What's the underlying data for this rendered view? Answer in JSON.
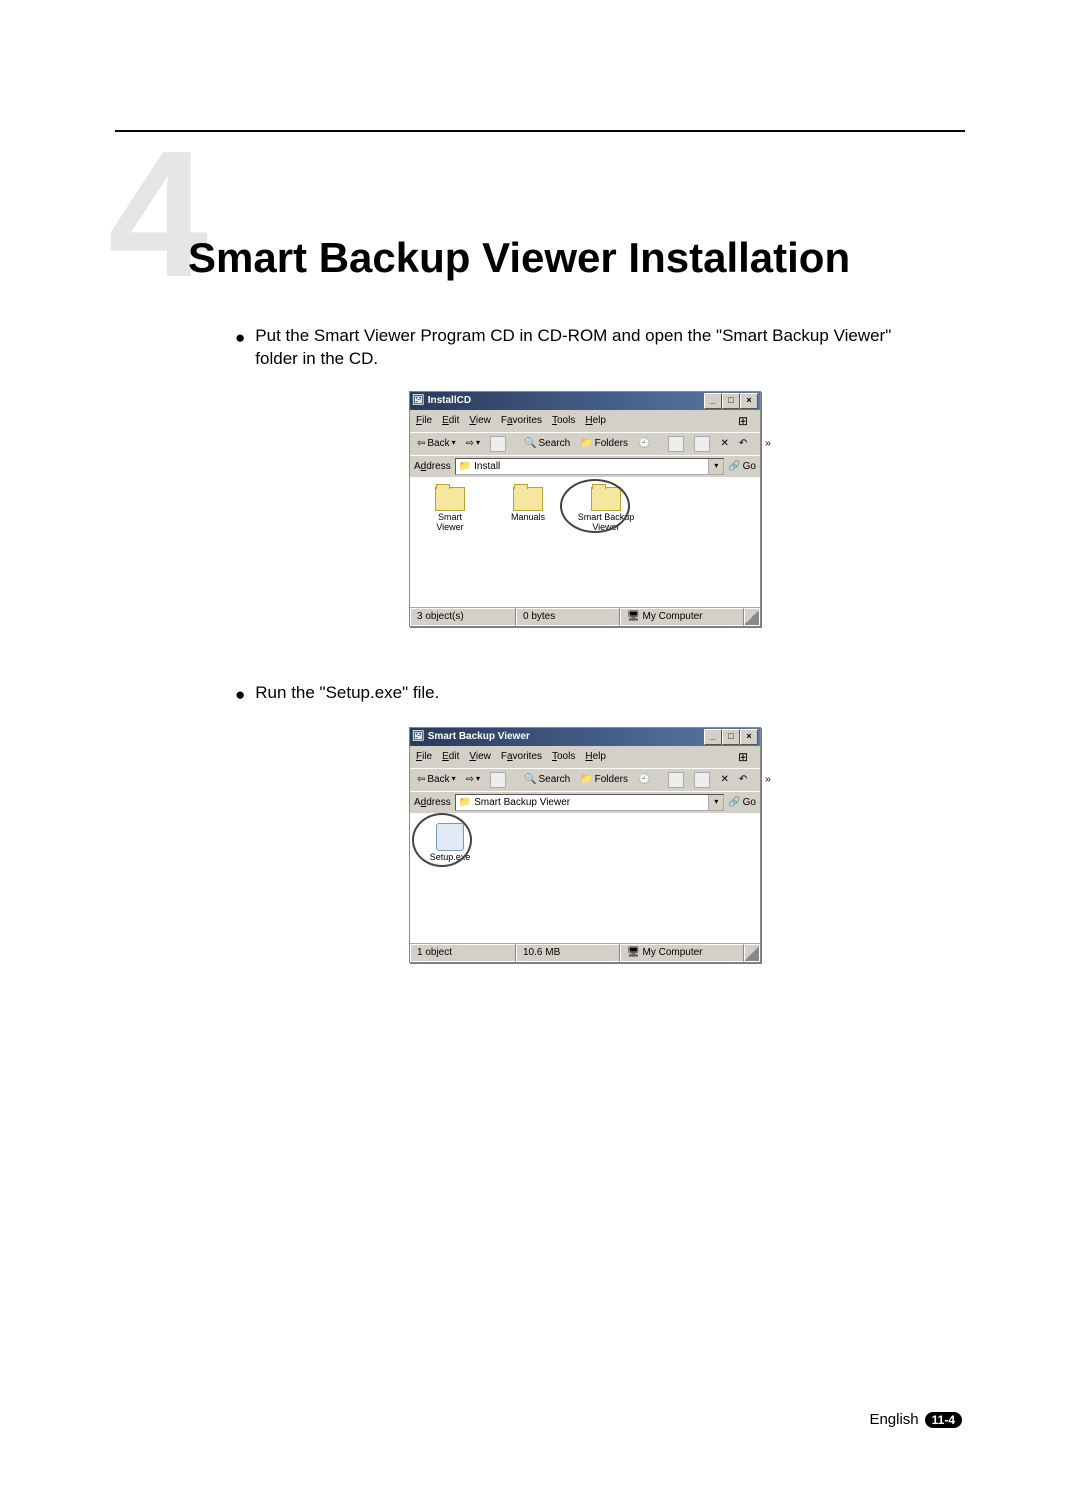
{
  "chapter": {
    "number": "4",
    "title": "Smart Backup Viewer Installation"
  },
  "bullets": {
    "b1": "Put the Smart Viewer Program CD in CD-ROM and open the \"Smart Backup Viewer\" folder in the CD.",
    "b2": "Run the \"Setup.exe\" file."
  },
  "explorer1": {
    "title": "InstallCD",
    "menus": {
      "file": "File",
      "edit": "Edit",
      "view": "View",
      "fav": "Favorites",
      "tools": "Tools",
      "help": "Help"
    },
    "toolbar": {
      "back": "Back",
      "search": "Search",
      "folders": "Folders"
    },
    "address_label": "Address",
    "address_value": "Install",
    "go": "Go",
    "items": {
      "i1": "Smart\nViewer",
      "i2": "Manuals",
      "i3": "Smart Backup\nViewer"
    },
    "status": {
      "left": "3 object(s)",
      "mid": "0 bytes",
      "right": "My Computer"
    }
  },
  "explorer2": {
    "title": "Smart Backup Viewer",
    "menus": {
      "file": "File",
      "edit": "Edit",
      "view": "View",
      "fav": "Favorites",
      "tools": "Tools",
      "help": "Help"
    },
    "toolbar": {
      "back": "Back",
      "search": "Search",
      "folders": "Folders"
    },
    "address_label": "Address",
    "address_value": "Smart Backup Viewer",
    "go": "Go",
    "items": {
      "i1": "Setup.exe"
    },
    "status": {
      "left": "1 object",
      "mid": "10.6 MB",
      "right": "My Computer"
    }
  },
  "footer": {
    "lang": "English",
    "page": "11-4"
  }
}
